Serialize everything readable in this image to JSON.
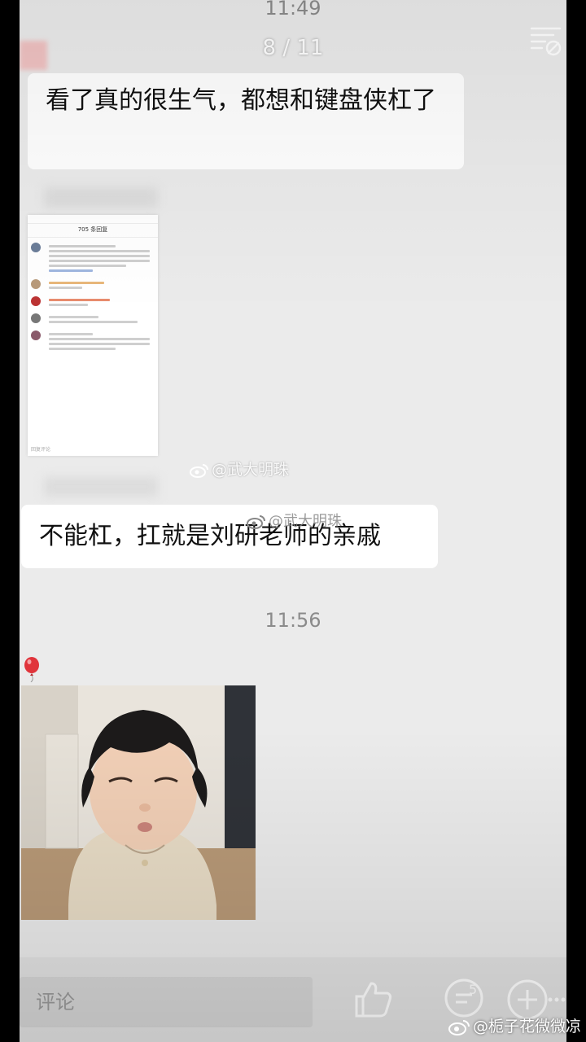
{
  "status": {
    "time_top": "11:49"
  },
  "viewer": {
    "counter": "8 / 11"
  },
  "messages": [
    {
      "text": "看了真的很生气，都想和键盘侠杠了"
    },
    {
      "text": "不能杠，扛就是刘研老师的亲戚"
    }
  ],
  "screenshot": {
    "title": "705 条回复",
    "footer": "回复评论"
  },
  "watermarks": {
    "wm1": "@武大明珠",
    "wm2": "@武大明珠"
  },
  "time_mid": "11:56",
  "bottom": {
    "comment_placeholder": "评论",
    "comment_count": "5",
    "credit": "@栀子花微微凉"
  },
  "icons": {
    "menu": "list-off-icon",
    "balloon": "balloon-icon",
    "like": "thumbs-up-icon",
    "comment": "comment-icon",
    "add": "plus-circle-icon",
    "more": "more-icon",
    "weibo": "weibo-icon"
  }
}
